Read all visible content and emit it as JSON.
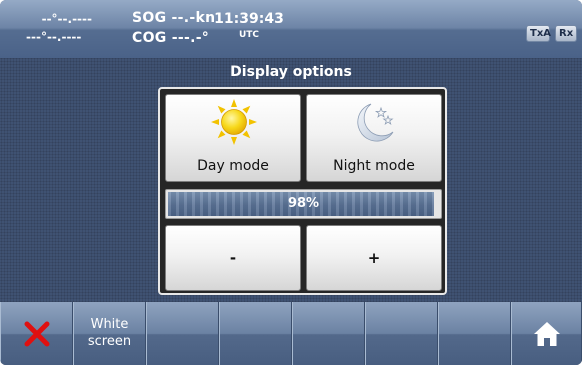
{
  "status": {
    "latitude": "--°--.----",
    "longitude": "---°--.----",
    "sog": "SOG --.-kn",
    "cog": "COG ---.-°",
    "time": "11:39:43",
    "timezone": "UTC",
    "indicators": [
      "TxA",
      "Rx"
    ]
  },
  "dialog": {
    "title": "Display options",
    "day_mode_label": "Day mode",
    "night_mode_label": "Night mode",
    "brightness_percent": 98,
    "brightness_label": "98%",
    "minus_label": "-",
    "plus_label": "+"
  },
  "softkeys": {
    "white_screen_line1": "White",
    "white_screen_line2": "screen"
  },
  "icons": {
    "close": "close-x-icon",
    "home": "home-icon",
    "day": "sun-icon",
    "night": "moon-stars-icon"
  },
  "colors": {
    "close_red": "#e01010",
    "sun_yellow": "#f7d81a",
    "bar_fill": "#5b7396"
  }
}
